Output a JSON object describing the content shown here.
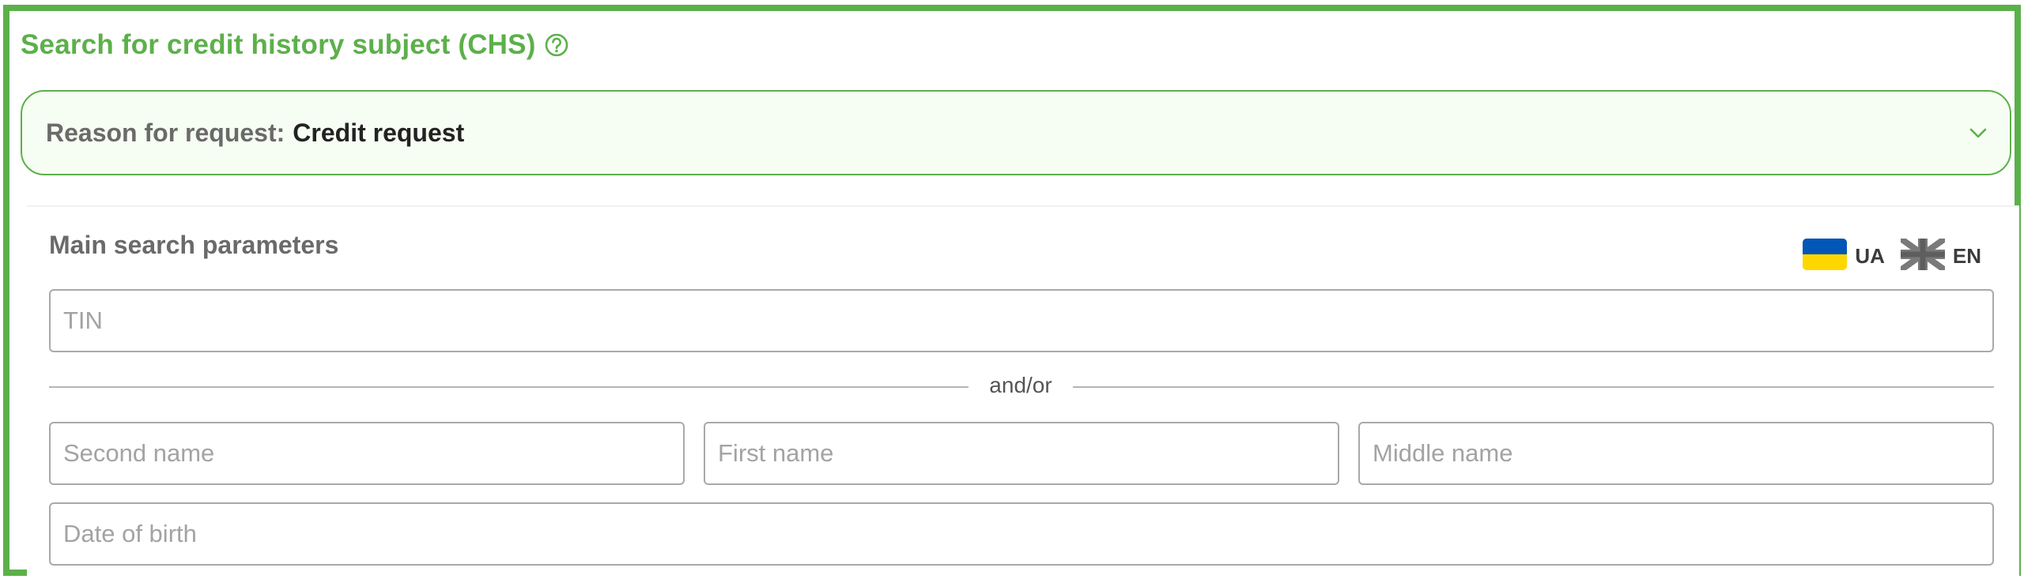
{
  "header": {
    "title": "Search for credit history subject (CHS)",
    "help_icon": "question-circle-icon"
  },
  "reason": {
    "label": "Reason for request:",
    "value": "Credit request",
    "expand_icon": "chevron-down-icon"
  },
  "search": {
    "section_title": "Main search parameters",
    "languages": [
      {
        "code": "UA",
        "flag_icon": "ukraine-flag-icon"
      },
      {
        "code": "EN",
        "flag_icon": "uk-flag-icon"
      }
    ],
    "tin_placeholder": "TIN",
    "divider_text": "and/or",
    "second_name_placeholder": "Second name",
    "first_name_placeholder": "First name",
    "middle_name_placeholder": "Middle name",
    "dob_placeholder": "Date of birth"
  },
  "colors": {
    "accent_green": "#5cb04a",
    "reason_bg": "#f6fdf2",
    "ua_blue": "#0057b7",
    "ua_yellow": "#ffd700",
    "flag_gray": "#7a7a7a"
  }
}
